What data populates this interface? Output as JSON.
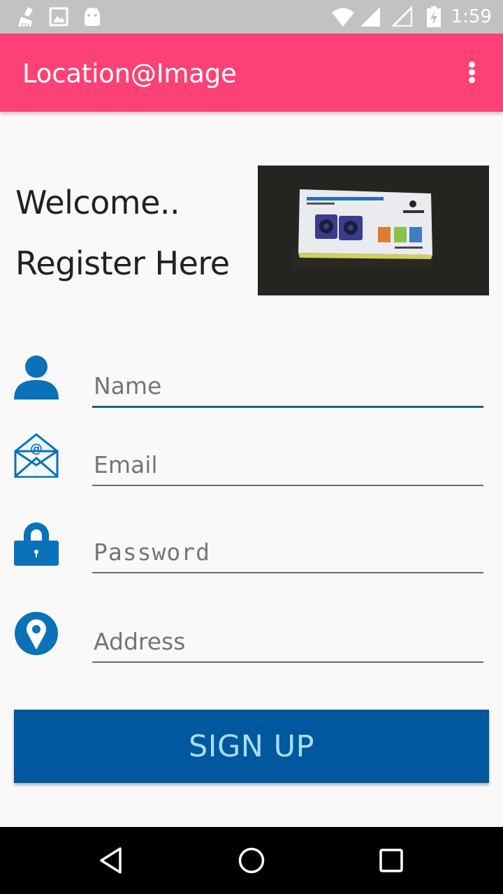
{
  "status_bar": {
    "time": "1:59",
    "icons": [
      "cleaner-icon",
      "image-icon",
      "android-icon",
      "wifi-icon",
      "signal-icon",
      "signal-empty-icon",
      "battery-charging-icon"
    ]
  },
  "app_bar": {
    "title": "Location@Image",
    "menu_icon": "overflow-menu-icon",
    "color": "#fb4176"
  },
  "header": {
    "welcome": "Welcome..",
    "register": "Register Here"
  },
  "form": {
    "name": {
      "placeholder": "Name",
      "value": "",
      "icon": "person-icon"
    },
    "email": {
      "placeholder": "Email",
      "value": "",
      "icon": "envelope-icon"
    },
    "password": {
      "placeholder": "Password",
      "value": "",
      "icon": "lock-icon"
    },
    "address": {
      "placeholder": "Address",
      "value": "",
      "icon": "location-pin-icon"
    },
    "icon_color": "#0a72b8"
  },
  "signup": {
    "label": "SIGN UP",
    "color": "#00589e"
  },
  "nav_bar": {
    "icons": [
      "back-icon",
      "home-icon",
      "recents-icon"
    ]
  }
}
